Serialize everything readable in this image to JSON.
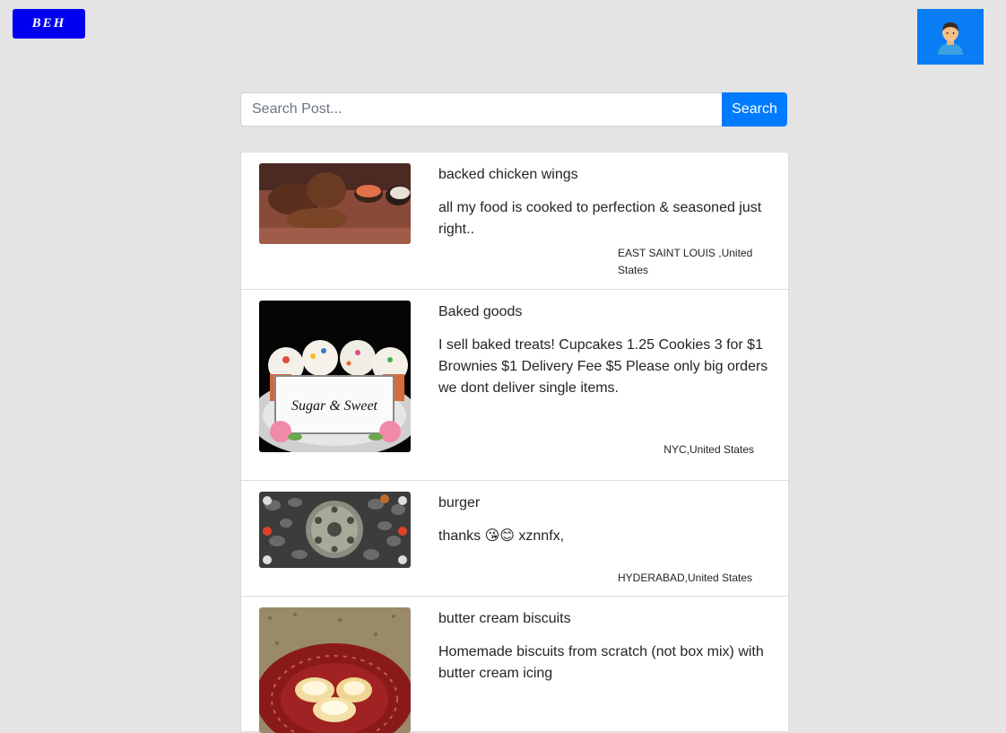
{
  "header": {
    "logo_text": "BEH",
    "avatar_icon": "user-avatar-icon"
  },
  "search": {
    "placeholder": "Search Post...",
    "button_label": "Search"
  },
  "posts": [
    {
      "title": "backed chicken wings",
      "description": "all my food is cooked to perfection & seasoned just right..",
      "location": "EAST SAINT LOUIS ,United States"
    },
    {
      "title": "Baked goods",
      "description": "I sell baked treats! Cupcakes 1.25 Cookies 3 for $1 Brownies $1 Delivery Fee $5 Please only big orders we dont deliver single items.",
      "location": "NYC,United States",
      "image_text": "Sugar & Sweet"
    },
    {
      "title": "burger",
      "description": "thanks 😘😊 xznnfx,",
      "location": "HYDERABAD,United States"
    },
    {
      "title": "butter cream biscuits",
      "description": "Homemade biscuits from scratch (not box mix) with butter cream icing",
      "location": ""
    }
  ],
  "colors": {
    "accent": "#007bff",
    "logo_bg": "#0000ee",
    "page_bg": "#e4e4e4"
  }
}
